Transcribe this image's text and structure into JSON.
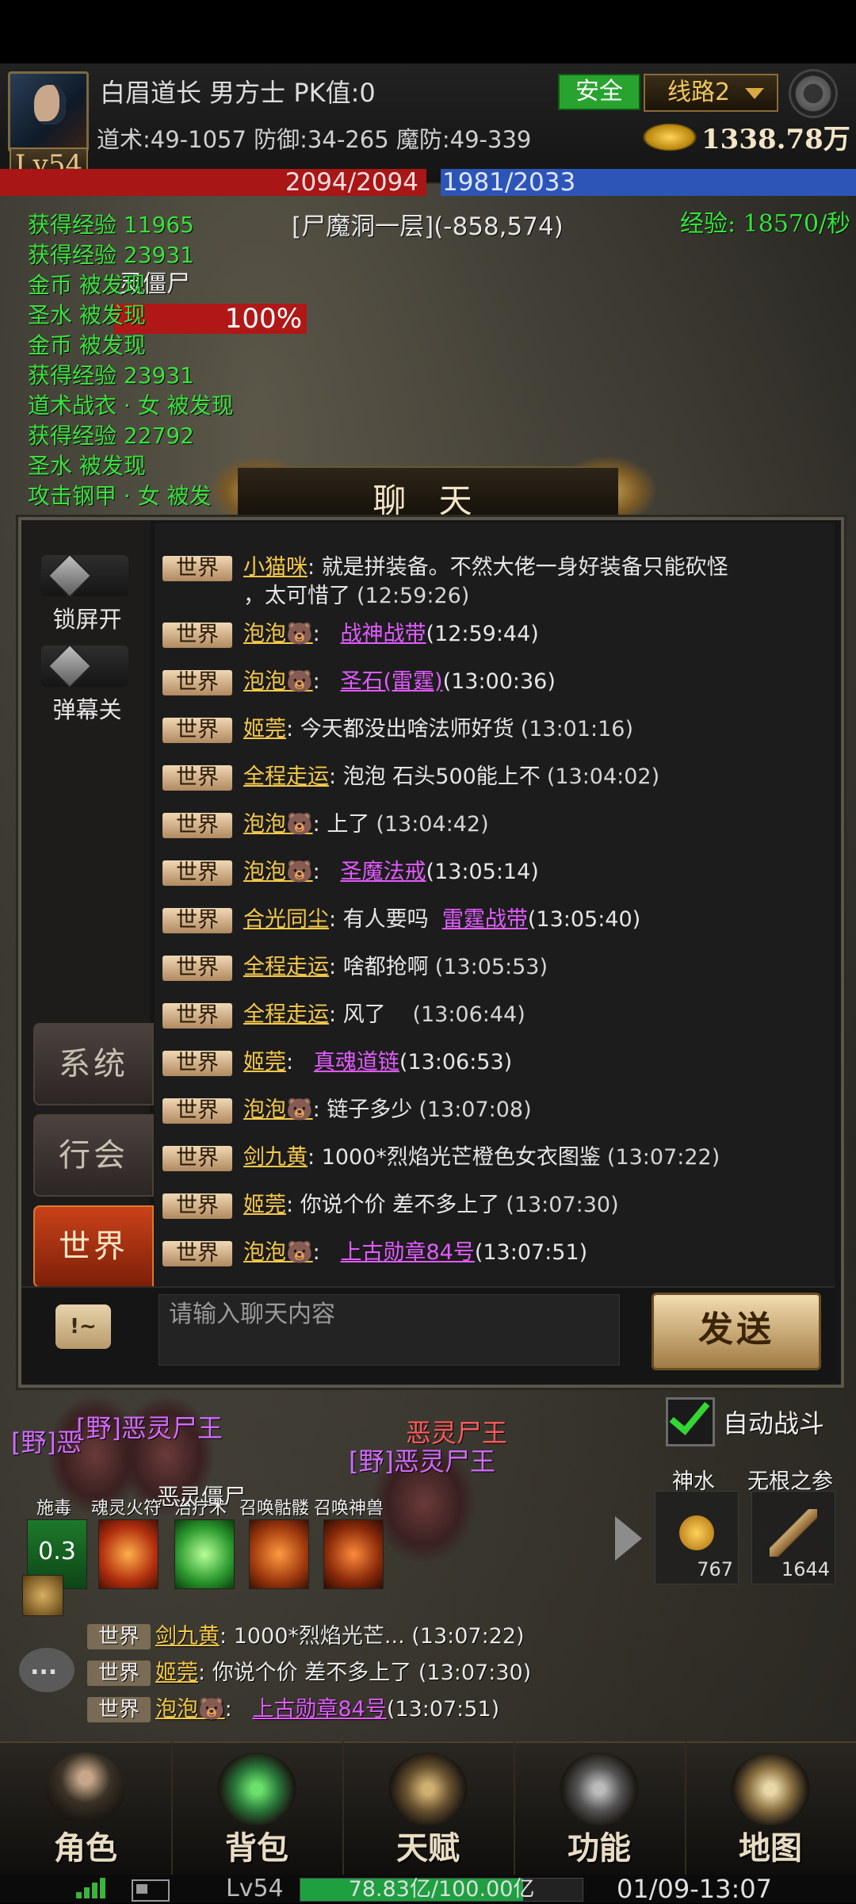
{
  "player": {
    "level": "Lv54",
    "name_line": "白眉道长  男方士  PK值:0",
    "stats": "道术:49-1057 防御:34-265 魔防:49-339",
    "safe": "安全",
    "line": "线路2",
    "gold": "1338.78万",
    "hp": "2094/2094",
    "mp": "1981/2033",
    "location": "[尸魔洞一层](-858,574)",
    "exp_rate": "经验: 18570/秒"
  },
  "log": [
    "获得经验 11965",
    "获得经验 23931",
    "金币 被发现",
    "圣水 被发现",
    "金币 被发现",
    "获得经验 23931",
    "道术战衣 · 女 被发现",
    "获得经验 22792",
    "圣水 被发现",
    "攻击钢甲 · 女 被发"
  ],
  "target": {
    "name": "灵僵尸",
    "hp": "100%"
  },
  "chat": {
    "title": "聊 天",
    "lock_label": "锁屏开",
    "barrage_label": "弹幕关",
    "tabs": [
      "系统",
      "行会",
      "世界"
    ],
    "input_placeholder": "请输入聊天内容",
    "send_label": "发送",
    "emote_label": "!~",
    "messages": [
      {
        "channel": "世界",
        "sender": "小猫咪",
        "text": "就是拼装备。不然大佬一身好装备只能砍怪",
        "text2": "，太可惜了",
        "item": "",
        "time": "(12:59:26)"
      },
      {
        "channel": "世界",
        "sender": "泡泡🐻",
        "text": "",
        "item": "战神战带",
        "time": "(12:59:44)"
      },
      {
        "channel": "世界",
        "sender": "泡泡🐻",
        "text": "",
        "item": "圣石(雷霆)",
        "time": "(13:00:36)"
      },
      {
        "channel": "世界",
        "sender": "姬莞",
        "text": "今天都没出啥法师好货",
        "item": "",
        "time": "(13:01:16)"
      },
      {
        "channel": "世界",
        "sender": "全程走运",
        "text": "泡泡  石头500能上不",
        "item": "",
        "time": "(13:04:02)"
      },
      {
        "channel": "世界",
        "sender": "泡泡🐻",
        "text": "上了",
        "item": "",
        "time": "(13:04:42)"
      },
      {
        "channel": "世界",
        "sender": "泡泡🐻",
        "text": "",
        "item": "圣魔法戒",
        "time": "(13:05:14)"
      },
      {
        "channel": "世界",
        "sender": "合光同尘",
        "text": "有人要吗",
        "item": "雷霆战带",
        "time": "(13:05:40)"
      },
      {
        "channel": "世界",
        "sender": "全程走运",
        "text": "啥都抢啊",
        "item": "",
        "time": "(13:05:53)"
      },
      {
        "channel": "世界",
        "sender": "全程走运",
        "text": "风了",
        "item": "",
        "time": "(13:06:44)"
      },
      {
        "channel": "世界",
        "sender": "姬莞",
        "text": "",
        "item": "真魂道链",
        "time": "(13:06:53)"
      },
      {
        "channel": "世界",
        "sender": "泡泡🐻",
        "text": "链子多少",
        "item": "",
        "time": "(13:07:08)"
      },
      {
        "channel": "世界",
        "sender": "剑九黄",
        "text": "1000*烈焰光芒橙色女衣图鉴",
        "item": "",
        "time": "(13:07:22)"
      },
      {
        "channel": "世界",
        "sender": "姬莞",
        "text": "你说个价 差不多上了",
        "item": "",
        "time": "(13:07:30)"
      },
      {
        "channel": "世界",
        "sender": "泡泡🐻",
        "text": "",
        "item": "上古勋章84号",
        "time": "(13:07:51)"
      }
    ]
  },
  "auto_battle": "自动战斗",
  "enemies": [
    "[野]恶灵尸王",
    "恶灵尸王",
    "[野]恶灵尸王",
    "[野]恶",
    "恶灵僵尸"
  ],
  "skills": [
    {
      "label": "施毒",
      "cd": "0.3"
    },
    {
      "label": "魂灵火符",
      "cd": ""
    },
    {
      "label": "治疗术",
      "cd": ""
    },
    {
      "label": "召唤骷髅",
      "cd": ""
    },
    {
      "label": "召唤神兽",
      "cd": ""
    }
  ],
  "items": [
    {
      "name": "神水",
      "count": "767"
    },
    {
      "name": "无根之参",
      "count": "1644"
    }
  ],
  "mini_chat": [
    {
      "channel": "世界",
      "sender": "剑九黄",
      "text": "1000*烈焰光芒...",
      "time": "(13:07:22)"
    },
    {
      "channel": "世界",
      "sender": "姬莞",
      "text": "你说个价 差不多上了",
      "time": "(13:07:30)"
    },
    {
      "channel": "世界",
      "sender": "泡泡🐻",
      "item": "上古勋章84号",
      "time": "(13:07:51)"
    }
  ],
  "nav": [
    "角色",
    "背包",
    "天赋",
    "功能",
    "地图"
  ],
  "status": {
    "level": "Lv54",
    "exp_text": "78.83亿/100.00亿",
    "exp_fraction": 0.7883,
    "clock": "01/09-13:07"
  }
}
